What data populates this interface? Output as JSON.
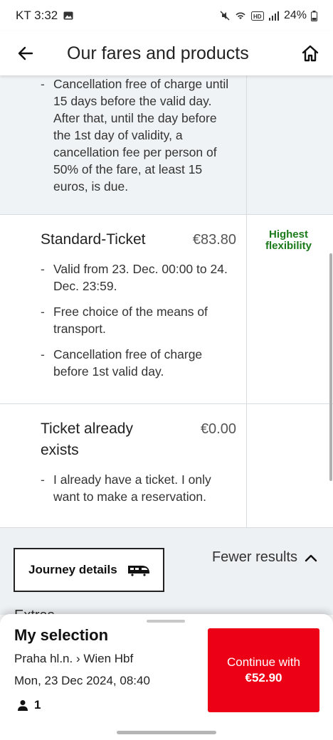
{
  "status_bar": {
    "carrier_time": "KT 3:32",
    "battery": "24%"
  },
  "app_bar": {
    "title": "Our fares and products",
    "back_icon": "arrow-left-icon",
    "home_icon": "home-icon"
  },
  "fares": [
    {
      "bullets": [
        "Cancellation free of charge until 15 days before the valid day. After that, until the day before the 1st day of validity, a cancellation fee per person of 50% of the fare, at least 15 euros, is due."
      ]
    },
    {
      "name": "Standard-Ticket",
      "price": "€83.80",
      "badge": "Highest flexibility",
      "bullets": [
        "Valid from 23. Dec. 00:00 to 24. Dec. 23:59.",
        "Free choice of the means of transport.",
        "Cancellation free of charge before 1st valid day."
      ]
    },
    {
      "name": "Ticket already exists",
      "price": "€0.00",
      "bullets": [
        "I already have a ticket. I only want to make a reservation."
      ]
    }
  ],
  "journey": {
    "details_label": "Journey details",
    "fewer_results_label": "Fewer results",
    "extras_peek": "Extras"
  },
  "selection": {
    "title": "My selection",
    "route": "Praha hl.n. › Wien Hbf",
    "datetime": "Mon, 23 Dec 2024, 08:40",
    "passengers": "1",
    "continue_label": "Continue with",
    "continue_amount": "€52.90"
  },
  "colors": {
    "accent_red": "#ec0016",
    "badge_green": "#1a7a1a",
    "muted_bg": "#f0f3f5"
  }
}
